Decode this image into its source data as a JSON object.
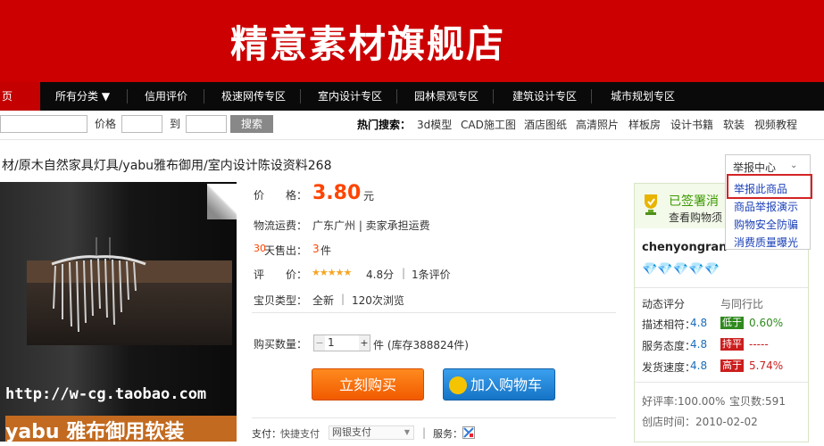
{
  "banner": {
    "title": "精意素材旗舰店"
  },
  "nav": {
    "items": [
      "页",
      "所有分类 ▼",
      "信用评价",
      "极速网传专区",
      "室内设计专区",
      "园林景观专区",
      "建筑设计专区",
      "城市规划专区"
    ]
  },
  "search": {
    "price_label": "价格",
    "to_label": "到",
    "button": "搜索",
    "hot_label": "热门搜索：",
    "hot_items": [
      "3d模型",
      "CAD施工图",
      "酒店图纸",
      "高清照片",
      "样板房",
      "设计书籍",
      "软装",
      "视频教程"
    ]
  },
  "product": {
    "title": "材/原木自然家具灯具/yabu雅布御用/室内设计陈设资料268",
    "price_label": "价　　格：",
    "price": "3.80",
    "price_unit": "元",
    "shipping_label": "物流运费：",
    "shipping_value": "广东广州 | 卖家承担运费",
    "sold_prefix": "30",
    "sold_label": "天售出：",
    "sold_value": "3",
    "sold_unit": "件",
    "rating_label": "评　　价：",
    "rating_stars": "★★★★★",
    "rating_score": "4.8分",
    "rating_sep": "|",
    "rating_count": "1条评价",
    "type_label": "宝贝类型：",
    "type_value": "全新",
    "type_sep": "|",
    "views": "120次浏览",
    "qty_label": "购买数量：",
    "qty_minus": "−",
    "qty_value": "1",
    "qty_plus": "+",
    "qty_stock": "件 (库存388824件)",
    "buy_button": "立刻购买",
    "cart_button": "加入购物车",
    "pay_label": "支付：",
    "pay_quick": "快捷支付",
    "pay_bank": "网银支付",
    "service_sep": "|",
    "service_label": "服务："
  },
  "photo": {
    "watermark_url": "http://w-cg.taobao.com",
    "watermark_text": "yabu 雅布御用软装"
  },
  "shop": {
    "signed": "已签署消",
    "view_service": "查看购物须",
    "seller": "chenyongran",
    "dynamic_label": "动态评分",
    "compare_label": "与同行比",
    "rows": [
      {
        "label": "描述相符：",
        "score": "4.8",
        "tag": "低于",
        "tag_color": "green",
        "pct": "0.60%"
      },
      {
        "label": "服务态度：",
        "score": "4.8",
        "tag": "持平",
        "tag_color": "red",
        "pct": "-----"
      },
      {
        "label": "发货速度：",
        "score": "4.8",
        "tag": "高于",
        "tag_color": "red",
        "pct": "5.74%"
      }
    ],
    "good_rate": "好评率:100.00%",
    "item_count": "宝贝数:591",
    "created": "创店时间：2010-02-02"
  },
  "report": {
    "head": "举报中心",
    "items": [
      "举报此商品",
      "商品举报演示",
      "购物安全防骗",
      "消费质量曝光"
    ]
  },
  "colors": {
    "banner_red": "#cc0000",
    "price_orange": "#ff4400",
    "buy_orange": "#f15a00",
    "cart_blue": "#1573c6",
    "link_blue": "#1a3fb7"
  }
}
